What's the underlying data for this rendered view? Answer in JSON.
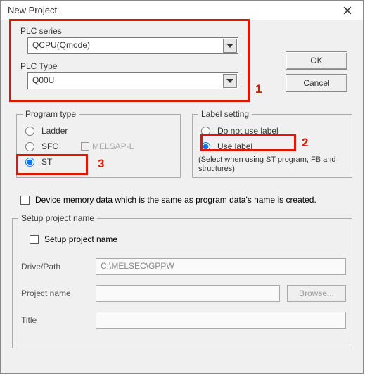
{
  "window": {
    "title": "New Project"
  },
  "buttons": {
    "ok": "OK",
    "cancel": "Cancel",
    "browse": "Browse..."
  },
  "plc": {
    "series_label": "PLC series",
    "series_value": "QCPU(Qmode)",
    "type_label": "PLC Type",
    "type_value": "Q00U"
  },
  "program_type": {
    "legend": "Program type",
    "ladder": "Ladder",
    "sfc": "SFC",
    "melsap": "MELSAP-L",
    "st": "ST",
    "selected": "ST"
  },
  "label_setting": {
    "legend": "Label setting",
    "no_label": "Do not use label",
    "use_label": "Use label",
    "note": "(Select when using ST program, FB and structures)",
    "selected": "Use label"
  },
  "device_memory": {
    "label": "Device memory data which is the same as program data's name is created."
  },
  "setup": {
    "legend": "Setup project name",
    "checkbox_label": "Setup project name",
    "drive_label": "Drive/Path",
    "drive_value": "C:\\MELSEC\\GPPW",
    "project_label": "Project name",
    "project_value": "",
    "title_label": "Title",
    "title_value": ""
  },
  "annotations": {
    "a1": "1",
    "a2": "2",
    "a3": "3"
  }
}
